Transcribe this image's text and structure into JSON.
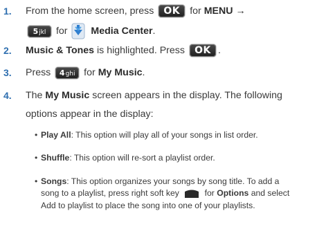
{
  "steps": [
    {
      "number": "1.",
      "line1": {
        "pre": "From the home screen, press",
        "key": "OK",
        "mid": "for",
        "menu": "MENU",
        "arrow": "→"
      },
      "line2": {
        "key_digit": "5",
        "key_letters": "jkl",
        "for": "for",
        "media": "Media Center",
        "period": "."
      }
    },
    {
      "number": "2.",
      "bold": "Music & Tones",
      "text": "is highlighted. Press",
      "key": "OK",
      "period": "."
    },
    {
      "number": "3.",
      "pre": "Press",
      "key_digit": "4",
      "key_letters": "ghi",
      "mid": "for",
      "bold": "My Music",
      "period": "."
    },
    {
      "number": "4.",
      "pre": "The",
      "bold": "My Music",
      "post": "screen appears in the display. The following",
      "line2": "options appear in the display:"
    }
  ],
  "bullets": [
    {
      "term": "Play All",
      "text": ": This option will play all of your songs in list order."
    },
    {
      "term": "Shuffle",
      "text": ": This option will re-sort a playlist order."
    },
    {
      "term": "Songs",
      "text1": ": This option organizes your songs by song title. To add a",
      "text2a": "song to a playlist, press right soft key",
      "text2b": "for",
      "options": "Options",
      "text2c": "and select",
      "text3": "Add to playlist to place the song into one of your playlists."
    }
  ],
  "icons": {
    "ok_key": "ok-key-icon",
    "media_center": "media-center-icon",
    "right_softkey": "right-softkey-icon"
  },
  "colors": {
    "step_number": "#2f6fb0",
    "key_background": "#2a2a2a",
    "media_icon_blue": "#2f7fd0"
  }
}
